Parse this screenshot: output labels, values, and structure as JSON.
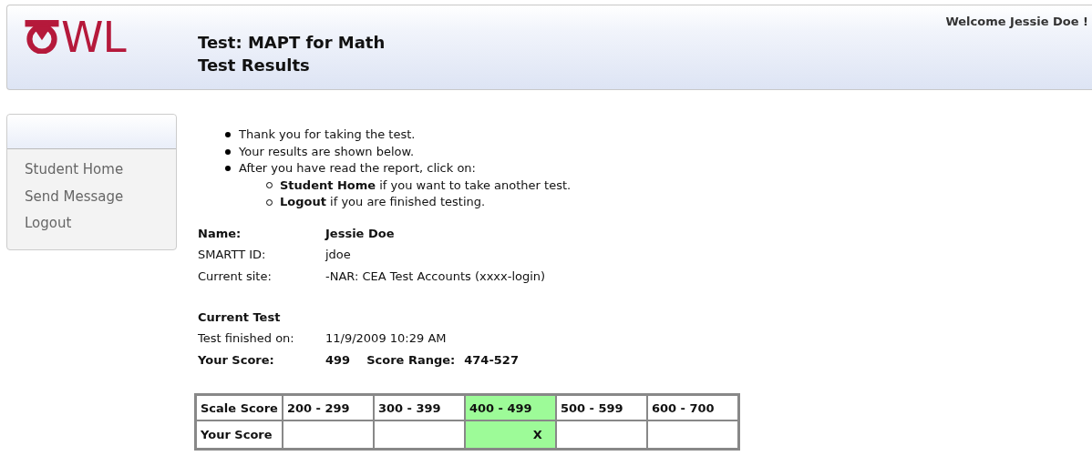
{
  "header": {
    "logo": "WL",
    "title": "Test: MAPT for Math",
    "subtitle": "Test Results",
    "welcome": "Welcome Jessie Doe !"
  },
  "sidebar": {
    "items": [
      {
        "label": "Student Home"
      },
      {
        "label": "Send Message"
      },
      {
        "label": "Logout"
      }
    ]
  },
  "instructions": [
    {
      "text": "Thank you for taking the test."
    },
    {
      "text": "Your results are shown below."
    },
    {
      "text": "After you have read the report, click on:",
      "children": [
        {
          "text": "**Student Home** if you want to take another test."
        },
        {
          "text": "**Logout** if you are finished testing."
        }
      ]
    }
  ],
  "student_info": [
    {
      "label": "Name:",
      "value": "Jessie Doe",
      "bold": true
    },
    {
      "label": "SMARTT ID:",
      "value": "jdoe",
      "bold": false
    },
    {
      "label": "Current site:",
      "value": "-NAR: CEA Test Accounts (xxxx-login)",
      "bold": false
    }
  ],
  "current_test": {
    "heading": "Current Test",
    "finished_label": "Test finished on:",
    "finished_value": "11/9/2009 10:29 AM",
    "score_label": "Your Score:",
    "score_value": "499",
    "range_label": "Score Range:",
    "range_value": "474-527"
  },
  "score_table": {
    "corner": "Scale Score",
    "columns": [
      {
        "label": "200 - 299",
        "selected": false
      },
      {
        "label": "300 - 399",
        "selected": false
      },
      {
        "label": "400 - 499",
        "selected": true
      },
      {
        "label": "500 - 599",
        "selected": false
      },
      {
        "label": "600 - 700",
        "selected": false
      }
    ],
    "row_label": "Your Score",
    "cells": [
      {
        "selected": false
      },
      {
        "selected": false
      },
      {
        "selected": true,
        "mark": "X"
      },
      {
        "selected": false
      },
      {
        "selected": false
      }
    ]
  }
}
